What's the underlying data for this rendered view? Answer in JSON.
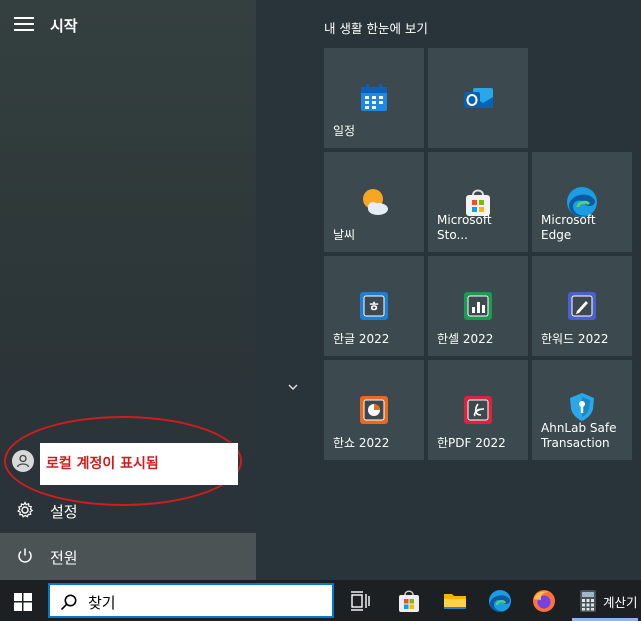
{
  "start": {
    "title": "시작",
    "user_overlay_text": "로컬 계정이 표시됨",
    "settings_label": "설정",
    "power_label": "전원"
  },
  "tiles": {
    "header": "내 생활 한눈에 보기",
    "items": [
      {
        "label": "일정",
        "icon": "calendar-icon"
      },
      {
        "label": "",
        "icon": "outlook-icon"
      },
      {
        "label": "날씨",
        "icon": "weather-icon"
      },
      {
        "label": "Microsoft Sto...",
        "icon": "store-icon"
      },
      {
        "label": "Microsoft Edge",
        "icon": "edge-icon"
      },
      {
        "label": "한글 2022",
        "icon": "hangul-icon"
      },
      {
        "label": "한셀 2022",
        "icon": "hancell-icon"
      },
      {
        "label": "한워드 2022",
        "icon": "hanword-icon"
      },
      {
        "label": "한쇼 2022",
        "icon": "hanshow-icon"
      },
      {
        "label": "한PDF 2022",
        "icon": "hanpdf-icon"
      },
      {
        "label": "AhnLab Safe Transaction",
        "icon": "ahnlab-shield-icon"
      }
    ]
  },
  "taskbar": {
    "search_text": "찾기",
    "calculator_label": "계산기"
  },
  "colors": {
    "accent": "#0078d4",
    "annotation_red": "#d11c1c",
    "tile_bg": "#3c4a4f"
  }
}
